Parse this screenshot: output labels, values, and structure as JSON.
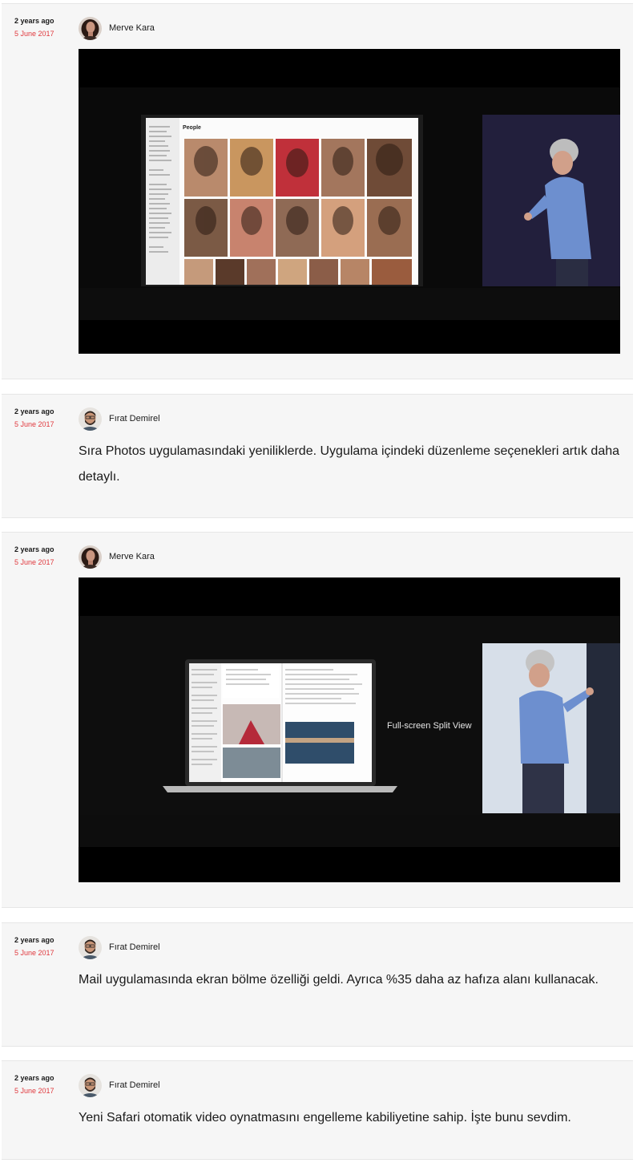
{
  "posts": [
    {
      "relative_time": "2 years ago",
      "date": "5 June 2017",
      "author": "Merve Kara",
      "avatar": "merve-avatar",
      "type": "image",
      "image": "photos-people-keynote-slide"
    },
    {
      "relative_time": "2 years ago",
      "date": "5 June 2017",
      "author": "Fırat Demirel",
      "avatar": "firat-avatar",
      "type": "text",
      "text": "Sıra Photos uygulamasındaki yeniliklerde. Uygulama içindeki düzenleme seçenekleri artık daha detaylı."
    },
    {
      "relative_time": "2 years ago",
      "date": "5 June 2017",
      "author": "Merve Kara",
      "avatar": "merve-avatar",
      "type": "image",
      "image": "mail-split-view-keynote-slide",
      "slide_caption": "Full-screen Split View"
    },
    {
      "relative_time": "2 years ago",
      "date": "5 June 2017",
      "author": "Fırat Demirel",
      "avatar": "firat-avatar",
      "type": "text",
      "text": "Mail uygulamasında ekran bölme özelliği geldi. Ayrıca %35 daha az hafıza alanı kullanacak."
    },
    {
      "relative_time": "2 years ago",
      "date": "5 June 2017",
      "author": "Fırat Demirel",
      "avatar": "firat-avatar",
      "type": "text",
      "text": "Yeni Safari otomatik video oynatmasını engelleme kabiliyetine sahip. İşte bunu sevdim."
    }
  ],
  "photos_slide": {
    "title": "People",
    "face_colors": [
      "#b98a6c",
      "#c9965f",
      "#c0303a",
      "#a3765d",
      "#6f4b37",
      "#7b5a45",
      "#c8836e",
      "#8f6a55",
      "#d4a07d",
      "#9a6d52"
    ]
  },
  "colors": {
    "accent_date": "#e0393e",
    "card_bg": "#f6f6f6",
    "text": "#1a1a1a"
  }
}
